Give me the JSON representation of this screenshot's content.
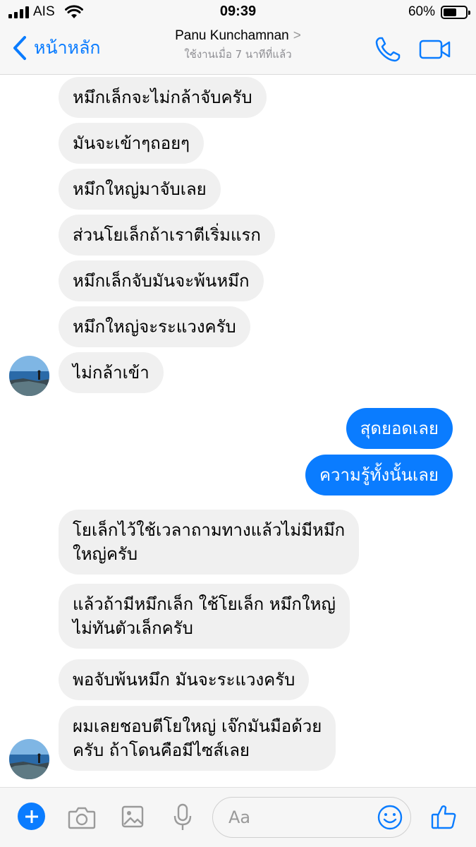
{
  "status_bar": {
    "carrier": "AIS",
    "time": "09:39",
    "battery_text": "60%",
    "battery_level": 0.6
  },
  "header": {
    "back_label": "หน้าหลัก",
    "contact_name": "Panu Kunchamnan",
    "chevron": ">",
    "active_status": "ใช้งานเมื่อ 7 นาทีที่แล้ว",
    "call_icon": "phone-icon",
    "video_icon": "video-camera-icon"
  },
  "messages": [
    {
      "from": "them",
      "text": "หมึกเล็กจะไม่กล้าจับครับ"
    },
    {
      "from": "them",
      "text": "มันจะเข้าๆถอยๆ"
    },
    {
      "from": "them",
      "text": "หมึกใหญ่มาจับเลย"
    },
    {
      "from": "them",
      "text": "ส่วนโยเล็กถ้าเราตีเริ่มแรก"
    },
    {
      "from": "them",
      "text": "หมึกเล็กจับมันจะพ้นหมึก"
    },
    {
      "from": "them",
      "text": "หมึกใหญ่จะระแวงครับ"
    },
    {
      "from": "them",
      "text": "ไม่กล้าเข้า"
    },
    {
      "from": "me",
      "text": "สุดยอดเลย"
    },
    {
      "from": "me",
      "text": "ความรู้ทั้งนั้นเลย"
    },
    {
      "from": "them",
      "text": "โยเล็กไว้ใช้เวลาถามทางแล้วไม่มีหมึก\nใหญ่ครับ"
    },
    {
      "from": "them",
      "text": "แล้วถ้ามีหมึกเล็ก ใช้โยเล็ก หมึกใหญ่\nไม่ทันตัวเล็กครับ"
    },
    {
      "from": "them",
      "text": "พอจับพ้นหมึก มันจะระแวงครับ"
    },
    {
      "from": "them",
      "text": "ผมเลยชอบตีโยใหญ่ เจ๊กมันมือด้วย\nครับ ถ้าโดนคือมีไซส์เลย"
    }
  ],
  "composer": {
    "placeholder": "Aa",
    "icons": [
      "plus-icon",
      "camera-icon",
      "gallery-icon",
      "microphone-icon",
      "emoji-icon",
      "thumbs-up-icon"
    ]
  },
  "colors": {
    "accent": "#0a7cff",
    "incoming_bubble": "#f0f0f0",
    "outgoing_bubble": "#0a7cff"
  }
}
